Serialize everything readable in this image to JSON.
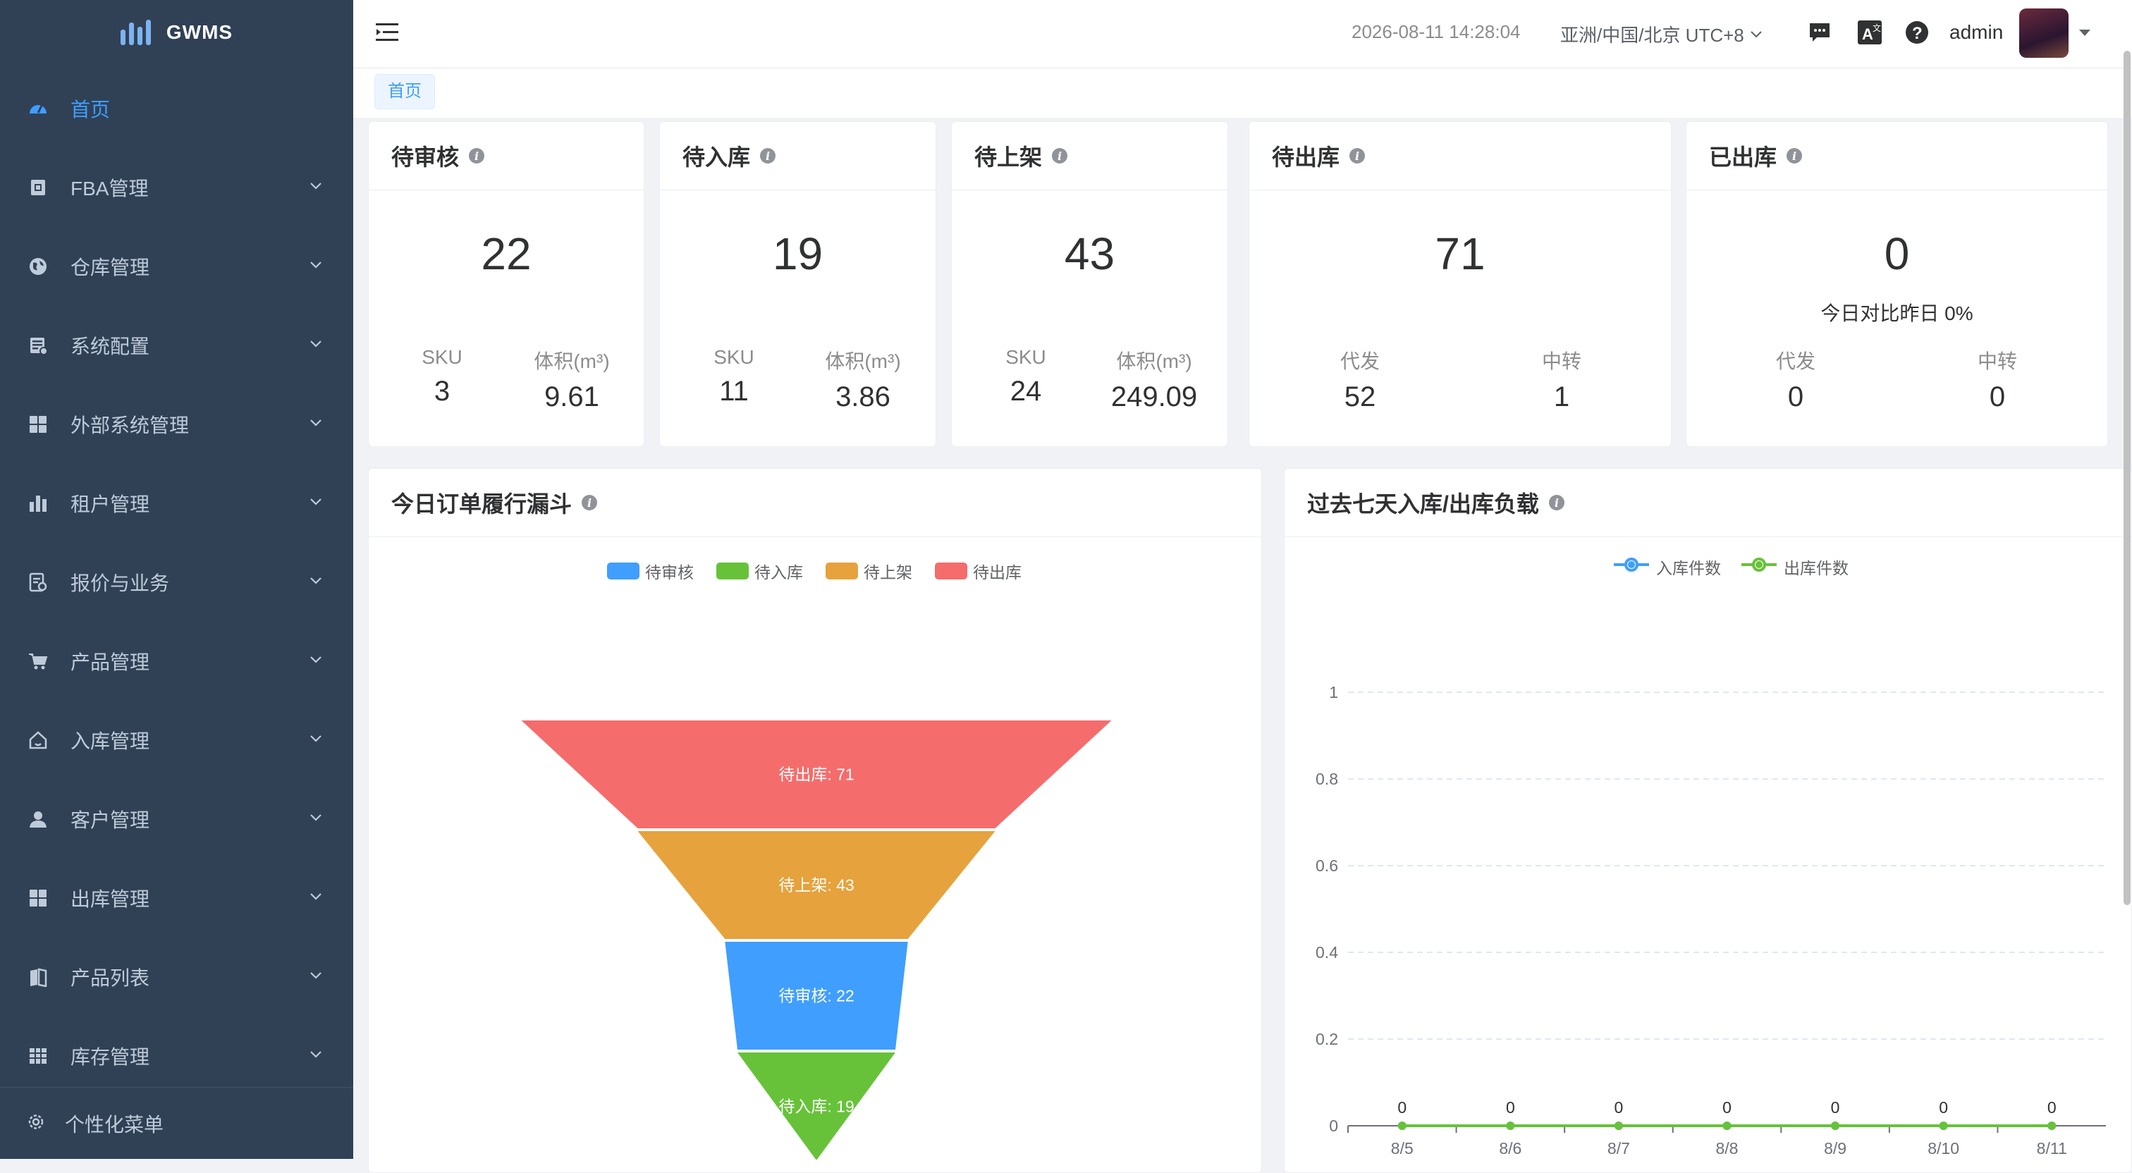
{
  "app": {
    "name": "GWMS"
  },
  "sidebar": {
    "items": [
      {
        "label": "首页",
        "icon": "dashboard-icon",
        "active": true
      },
      {
        "label": "FBA管理",
        "icon": "fba-icon"
      },
      {
        "label": "仓库管理",
        "icon": "globe-icon"
      },
      {
        "label": "系统配置",
        "icon": "system-config-icon"
      },
      {
        "label": "外部系统管理",
        "icon": "grid-icon"
      },
      {
        "label": "租户管理",
        "icon": "bar-chart-icon"
      },
      {
        "label": "报价与业务",
        "icon": "quote-icon"
      },
      {
        "label": "产品管理",
        "icon": "cart-icon"
      },
      {
        "label": "入库管理",
        "icon": "home-icon"
      },
      {
        "label": "客户管理",
        "icon": "user-icon"
      },
      {
        "label": "出库管理",
        "icon": "grid-icon"
      },
      {
        "label": "产品列表",
        "icon": "book-icon"
      },
      {
        "label": "库存管理",
        "icon": "table-icon"
      }
    ],
    "footer_label": "个性化菜单"
  },
  "header": {
    "datetime": "2026-08-11 14:28:04",
    "timezone": "亚洲/中国/北京 UTC+8",
    "username": "admin"
  },
  "tags": {
    "home": "首页"
  },
  "cards": [
    {
      "title": "待审核",
      "value": "22",
      "stats": [
        {
          "label": "SKU",
          "value": "3"
        },
        {
          "label": "体积(m³)",
          "value": "9.61"
        }
      ]
    },
    {
      "title": "待入库",
      "value": "19",
      "stats": [
        {
          "label": "SKU",
          "value": "11"
        },
        {
          "label": "体积(m³)",
          "value": "3.86"
        }
      ]
    },
    {
      "title": "待上架",
      "value": "43",
      "stats": [
        {
          "label": "SKU",
          "value": "24"
        },
        {
          "label": "体积(m³)",
          "value": "249.09"
        }
      ]
    },
    {
      "title": "待出库",
      "value": "71",
      "stats": [
        {
          "label": "代发",
          "value": "52"
        },
        {
          "label": "中转",
          "value": "1"
        }
      ]
    },
    {
      "title": "已出库",
      "value": "0",
      "note": "今日对比昨日  0%",
      "stats": [
        {
          "label": "代发",
          "value": "0"
        },
        {
          "label": "中转",
          "value": "0"
        }
      ]
    }
  ],
  "funnel": {
    "title": "今日订单履行漏斗",
    "legend": [
      "待审核",
      "待入库",
      "待上架",
      "待出库"
    ]
  },
  "load": {
    "title": "过去七天入库/出库负载",
    "legend": [
      "入库件数",
      "出库件数"
    ]
  },
  "colors": {
    "blue": "#409eff",
    "green": "#67c23a",
    "orange": "#e6a23c",
    "red": "#f56c6c",
    "sidebar": "#304156"
  },
  "chart_data": [
    {
      "type": "funnel",
      "title": "今日订单履行漏斗",
      "categories": [
        "待出库",
        "待上架",
        "待审核",
        "待入库"
      ],
      "values": [
        71,
        43,
        22,
        19
      ],
      "colors": [
        "#f56c6c",
        "#e6a23c",
        "#409eff",
        "#67c23a"
      ],
      "legend": [
        "待审核",
        "待入库",
        "待上架",
        "待出库"
      ],
      "legend_position": "top-center"
    },
    {
      "type": "line",
      "title": "过去七天入库/出库负载",
      "x": [
        "8/5",
        "8/6",
        "8/7",
        "8/8",
        "8/9",
        "8/10",
        "8/11"
      ],
      "series": [
        {
          "name": "入库件数",
          "values": [
            0,
            0,
            0,
            0,
            0,
            0,
            0
          ],
          "color": "#409eff"
        },
        {
          "name": "出库件数",
          "values": [
            0,
            0,
            0,
            0,
            0,
            0,
            0
          ],
          "color": "#67c23a"
        }
      ],
      "yticks": [
        "0",
        "0.2",
        "0.4",
        "0.6",
        "0.8",
        "1"
      ],
      "ylim": [
        0,
        1
      ],
      "grid": true,
      "legend_position": "top-center"
    }
  ]
}
